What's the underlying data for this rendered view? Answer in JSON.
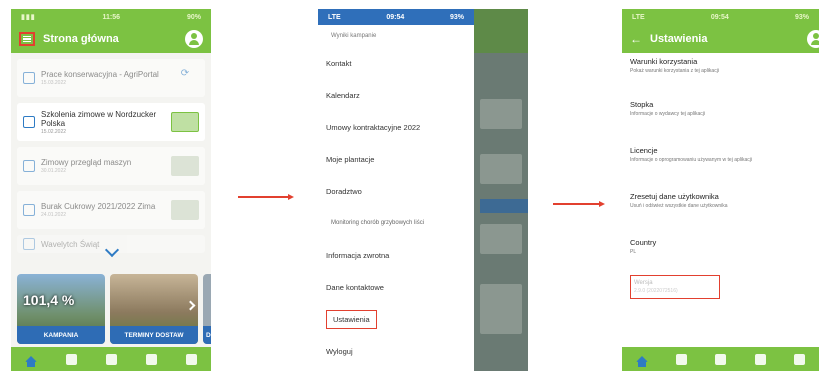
{
  "screen1": {
    "status_time": "11:56",
    "status_battery": "90%",
    "title": "Strona główna",
    "items": [
      {
        "title": "Prace konserwacyjna - AgriPortal",
        "date": "15.03.2022",
        "faded": true
      },
      {
        "title": "Szkolenia zimowe w Nordzucker Polska",
        "date": "15.02.2022",
        "faded": false
      },
      {
        "title": "Zimowy przegląd maszyn",
        "date": "30.01.2022",
        "faded": true
      },
      {
        "title": "Burak Cukrowy 2021/2022 Zima",
        "date": "24.01.2022",
        "faded": true
      },
      {
        "title": "Wavelytch Świąt",
        "date": "",
        "faded": true
      }
    ],
    "tiles": [
      {
        "percent": "101,4 %",
        "label": "KAMPANIA"
      },
      {
        "percent": "",
        "label": "TERMINY DOSTAW"
      },
      {
        "percent": "",
        "label": "DOS"
      }
    ]
  },
  "screen2": {
    "status_carrier": "LTE",
    "status_time": "09:54",
    "status_battery": "93%",
    "menu": [
      {
        "label": "Wyniki kampanie",
        "style": "sm"
      },
      {
        "label": "Kontakt",
        "style": ""
      },
      {
        "label": "Kalendarz",
        "style": ""
      },
      {
        "label": "Umowy kontraktacyjne 2022",
        "style": ""
      },
      {
        "label": "Moje plantacje",
        "style": ""
      },
      {
        "label": "Doradztwo",
        "style": ""
      },
      {
        "label": "Monitoring chorób grzybowych liści",
        "style": "sub"
      },
      {
        "label": "Informacja zwrotna",
        "style": ""
      },
      {
        "label": "Dane kontaktowe",
        "style": ""
      },
      {
        "label": "Ustawienia",
        "style": "hl"
      },
      {
        "label": "Wyloguj",
        "style": ""
      }
    ]
  },
  "screen3": {
    "status_carrier": "LTE",
    "status_time": "09:54",
    "status_battery": "93%",
    "title": "Ustawienia",
    "settings": [
      {
        "title": "Warunki korzystania",
        "sub": "Pokaż warunki korzystania z tej aplikacji"
      },
      {
        "title": "Stopka",
        "sub": "Informacje o wydawcy tej aplikacji"
      },
      {
        "title": "Licencje",
        "sub": "Informacje o oprogramowaniu używanym w tej aplikacji"
      },
      {
        "title": "Zresetuj dane użytkownika",
        "sub": "Usuń i odśwież wszystkie dane użytkownika"
      },
      {
        "title": "Country",
        "sub": "PL"
      }
    ],
    "version_title": "Wersja",
    "version_value": "2.9.0 (2022072516)"
  },
  "colors": {
    "brand_green": "#7cc242",
    "accent_blue": "#2e6cb5",
    "highlight_red": "#e2402f"
  }
}
